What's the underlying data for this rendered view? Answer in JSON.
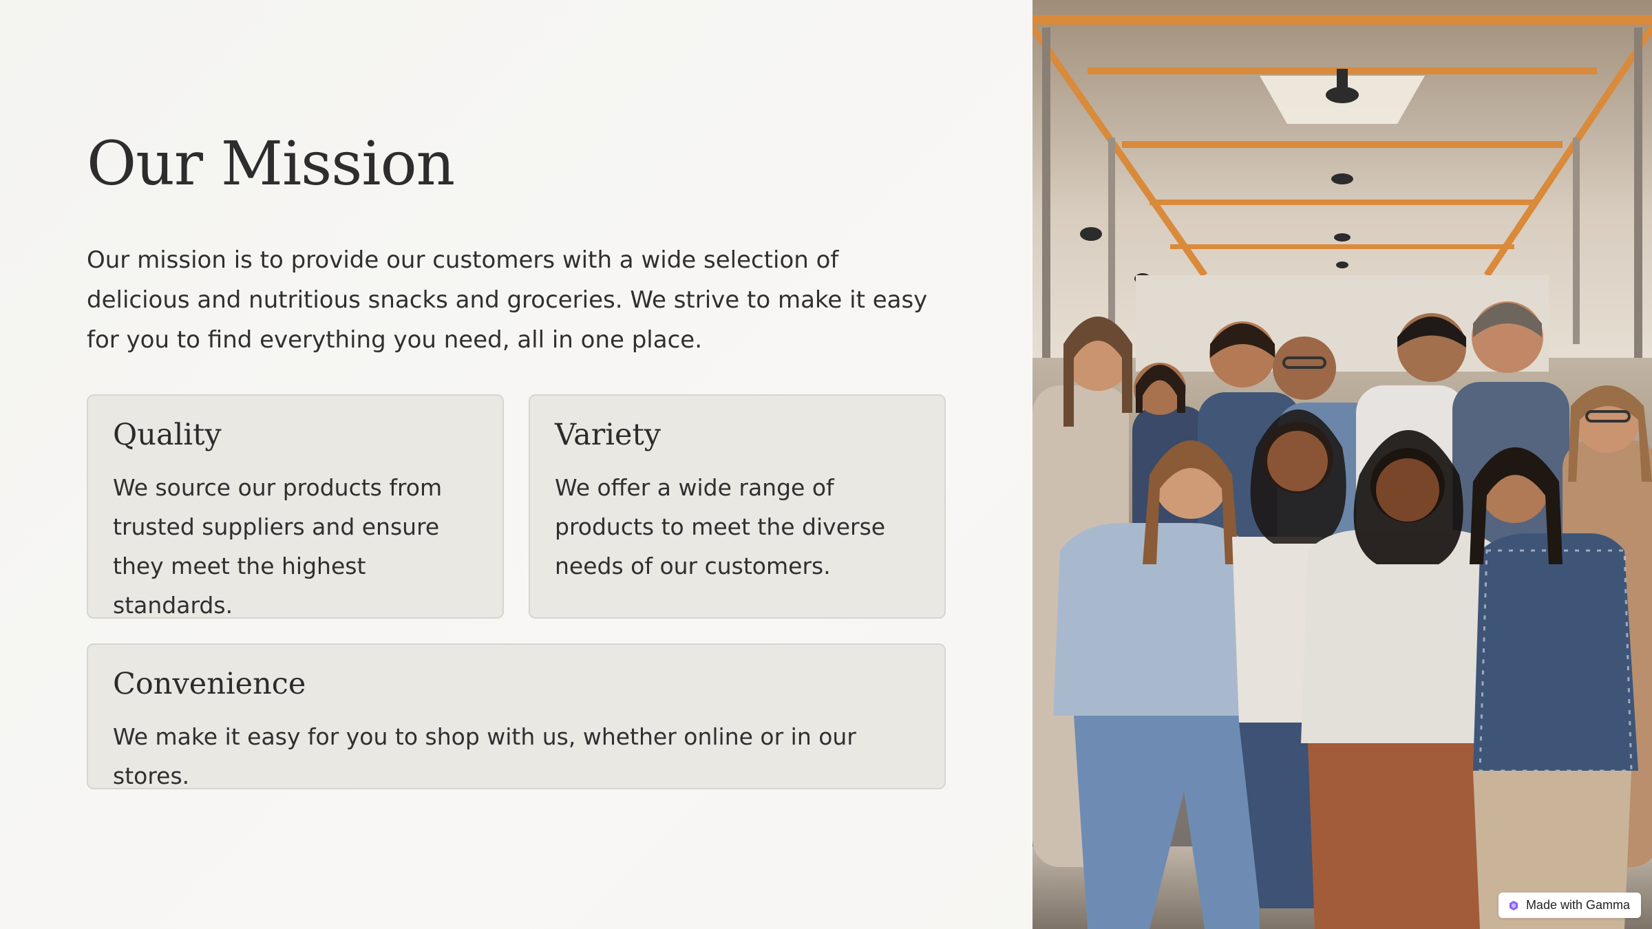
{
  "slide": {
    "title": "Our Mission",
    "intro": "Our mission is to provide our customers with a wide selection of delicious and nutritious snacks and groceries. We strive to make it easy for you to find everything you need, all in one place."
  },
  "cards": {
    "quality": {
      "title": "Quality",
      "body": "We source our products from trusted suppliers and ensure they meet the highest standards."
    },
    "variety": {
      "title": "Variety",
      "body": "We offer a wide range of products to meet the diverse needs of our customers."
    },
    "convenience": {
      "title": "Convenience",
      "body": "We make it easy for you to shop with us, whether online or in our stores."
    }
  },
  "photo": {
    "subject": "group-of-employees-in-warehouse-photo"
  },
  "badge": {
    "label": "Made with Gamma",
    "icon": "gamma-logo-icon"
  },
  "colors": {
    "background": "#f6f5f2",
    "card": "#e9e8e3",
    "card_border": "#d6d5cf",
    "text": "#2b2b2b",
    "beam": "#d98a3a",
    "badge_accent": "#8b5cf6"
  }
}
